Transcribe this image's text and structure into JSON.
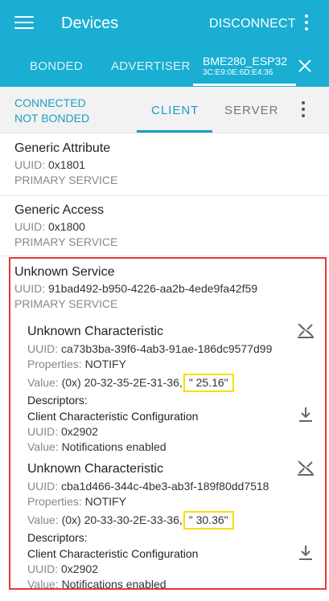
{
  "appbar": {
    "title": "Devices",
    "disconnect_label": "DISCONNECT"
  },
  "top_tabs": {
    "bonded": "BONDED",
    "advertiser": "ADVERTISER",
    "device_name": "BME280_ESP32",
    "device_mac": "3C:E9:0E:6D:E4:36"
  },
  "subbar": {
    "connection_status": "CONNECTED",
    "bond_status": "NOT BONDED",
    "tab_client": "CLIENT",
    "tab_server": "SERVER"
  },
  "labels": {
    "uuid": "UUID:",
    "properties": "Properties:",
    "value": "Value:",
    "descriptors": "Descriptors:"
  },
  "services": [
    {
      "name": "Generic Attribute",
      "uuid": "0x1801",
      "type": "PRIMARY SERVICE"
    },
    {
      "name": "Generic Access",
      "uuid": "0x1800",
      "type": "PRIMARY SERVICE"
    },
    {
      "name": "Unknown Service",
      "uuid": "91bad492-b950-4226-aa2b-4ede9fa42f59",
      "type": "PRIMARY SERVICE",
      "characteristics": [
        {
          "name": "Unknown Characteristic",
          "uuid": "ca73b3ba-39f6-4ab3-91ae-186dc9577d99",
          "properties": "NOTIFY",
          "value_hex": "(0x) 20-32-35-2E-31-36,",
          "value_text": "\" 25.16\"",
          "descriptor_name": "Client Characteristic Configuration",
          "descriptor_uuid": "0x2902",
          "descriptor_value": "Notifications enabled"
        },
        {
          "name": "Unknown Characteristic",
          "uuid": "cba1d466-344c-4be3-ab3f-189f80dd7518",
          "properties": "NOTIFY",
          "value_hex": "(0x) 20-33-30-2E-33-36,",
          "value_text": "\" 30.36\"",
          "descriptor_name": "Client Characteristic Configuration",
          "descriptor_uuid": "0x2902",
          "descriptor_value": "Notifications enabled"
        }
      ]
    }
  ],
  "colors": {
    "appbar": "#1aaed3",
    "accent": "#1a9fc2",
    "highlight_border": "#e53935",
    "value_highlight": "#f4e000"
  },
  "icons": {
    "menu": "menu-icon",
    "overflow": "more-vert-icon",
    "close": "close-icon",
    "notify": "notifications-off-icon",
    "download": "download-icon"
  }
}
